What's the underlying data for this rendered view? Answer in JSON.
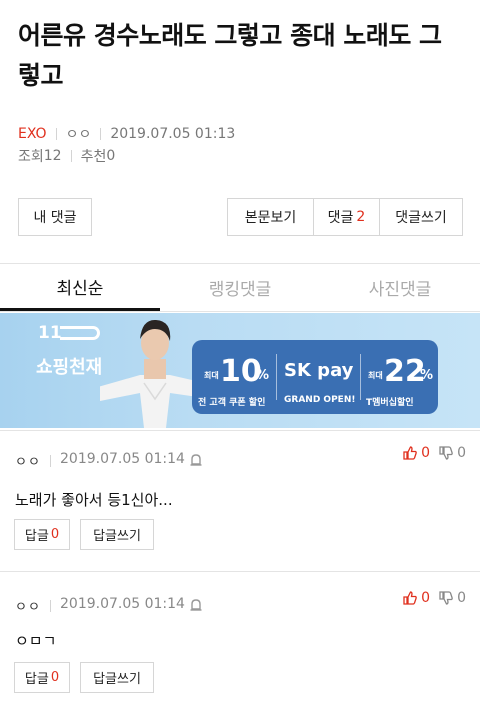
{
  "post": {
    "title": "어른유 경수노래도 그렇고 종대 노래도 그렇고",
    "category": "EXO",
    "author": "ㅇㅇ",
    "date": "2019.07.05 01:13",
    "views_label": "조회",
    "views": "12",
    "recommend_label": "추천",
    "recommend": "0"
  },
  "actions": {
    "my_comments": "내 댓글",
    "view_post": "본문보기",
    "comments_label": "댓글",
    "comments_count": "2",
    "write_comment": "댓글쓰기"
  },
  "tabs": [
    {
      "label": "최신순",
      "active": true
    },
    {
      "label": "랭킹댓글",
      "active": false
    },
    {
      "label": "사진댓글",
      "active": false
    }
  ],
  "banner": {
    "logo": "11",
    "shop_text": "쇼핑천재",
    "promo1_prefix": "최대",
    "promo1_value": "10",
    "promo1_unit": "%",
    "promo1_caption": "전 고객 쿠폰 할인",
    "promo2_logo": "SK pay",
    "promo2_caption": "GRAND OPEN!",
    "promo3_prefix": "최대",
    "promo3_value": "22",
    "promo3_unit": "%",
    "promo3_caption": "T멤버십할인",
    "colors": {
      "background": "#b5daf2",
      "panel": "#3a6fb3"
    }
  },
  "comments": [
    {
      "author": "ㅇㅇ",
      "date": "2019.07.05 01:14",
      "likes": "0",
      "dislikes": "0",
      "text": "노래가 좋아서 등1신아...",
      "reply_label": "답글",
      "reply_count": "0",
      "write_reply": "답글쓰기"
    },
    {
      "author": "ㅇㅇ",
      "date": "2019.07.05 01:14",
      "likes": "0",
      "dislikes": "0",
      "text": "ㅇㅁㄱ",
      "reply_label": "답글",
      "reply_count": "0",
      "write_reply": "답글쓰기"
    }
  ],
  "colors": {
    "accent": "#e0301e",
    "text": "#222222",
    "muted": "#888888"
  }
}
